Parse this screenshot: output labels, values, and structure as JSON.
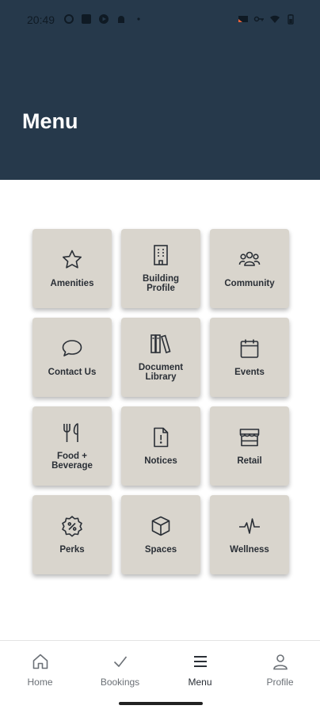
{
  "status_bar": {
    "time": "20:49",
    "left_icons": [
      "settings-icon",
      "app-icon",
      "play-icon",
      "android-icon",
      "dot-icon"
    ],
    "right_icons": [
      "cast-icon",
      "key-icon",
      "wifi-icon",
      "battery-icon"
    ]
  },
  "header": {
    "title": "Menu",
    "background": "#26394b"
  },
  "menu": {
    "tiles": [
      {
        "label": "Amenities",
        "icon": "star-icon"
      },
      {
        "label": "Building Profile",
        "icon": "building-icon"
      },
      {
        "label": "Community",
        "icon": "people-icon"
      },
      {
        "label": "Contact Us",
        "icon": "chat-bubble-icon"
      },
      {
        "label": "Document Library",
        "icon": "books-icon"
      },
      {
        "label": "Events",
        "icon": "calendar-icon"
      },
      {
        "label": "Food + Beverage",
        "icon": "fork-knife-icon"
      },
      {
        "label": "Notices",
        "icon": "notice-document-icon"
      },
      {
        "label": "Retail",
        "icon": "storefront-icon"
      },
      {
        "label": "Perks",
        "icon": "discount-badge-icon"
      },
      {
        "label": "Spaces",
        "icon": "cube-icon"
      },
      {
        "label": "Wellness",
        "icon": "pulse-icon"
      }
    ],
    "tile_color": "#d9d5cd"
  },
  "bottom_nav": {
    "items": [
      {
        "label": "Home",
        "icon": "home-icon"
      },
      {
        "label": "Bookings",
        "icon": "checkmark-icon"
      },
      {
        "label": "Menu",
        "icon": "menu-icon"
      },
      {
        "label": "Profile",
        "icon": "person-icon"
      }
    ],
    "active": "Menu"
  }
}
